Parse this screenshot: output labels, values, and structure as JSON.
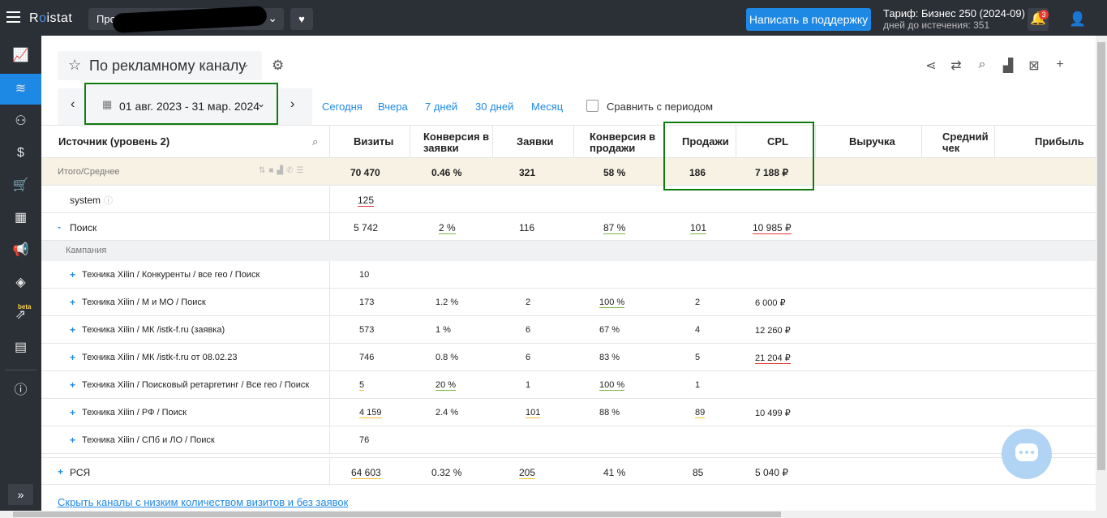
{
  "topbar": {
    "logo_pre": "R",
    "logo_dot": "o",
    "logo_post": "istat",
    "project": "Про",
    "support": "Написать в поддержку",
    "tariff": "Тариф: Бизнес 250 (2024-09)",
    "days": "дней до истечения: 351",
    "notifications": "3"
  },
  "sidebar": {
    "icons": [
      "analytics-icon",
      "layers-active-icon",
      "sitemap-icon",
      "money-icon",
      "cart-icon",
      "calendar-icon",
      "megaphone-icon",
      "stack-icon",
      "beta-report-icon",
      "scoreboard-icon",
      "info-icon"
    ],
    "beta": "beta",
    "expand": "»"
  },
  "report": {
    "title": "По рекламному каналу",
    "date_range": "01 авг. 2023 - 31 мар. 2024",
    "periods": [
      "Сегодня",
      "Вчера",
      "7 дней",
      "30 дней",
      "Месяц"
    ],
    "compare": "Сравнить с периодом"
  },
  "table": {
    "columns": {
      "source": "Источник (уровень 2)",
      "visits": "Визиты",
      "conv_req_1": "Конверсия в",
      "conv_req_2": "заявки",
      "requests": "Заявки",
      "conv_sales_1": "Конверсия в",
      "conv_sales_2": "продажи",
      "sales": "Продажи",
      "cpl": "CPL",
      "revenue": "Выручка",
      "avg_1": "Средний",
      "avg_2": "чек",
      "profit": "Прибыль"
    },
    "total": {
      "label": "Итого/Среднее",
      "visits": "70 470",
      "conv_req": "0.46 %",
      "requests": "321",
      "conv_sales": "58 %",
      "sales": "186",
      "cpl": "7 188 ₽"
    },
    "system": {
      "label": "system",
      "visits": "125"
    },
    "search": {
      "label": "Поиск",
      "toggle": "-",
      "visits": "5 742",
      "conv_req": "2 %",
      "requests": "116",
      "conv_sales": "87 %",
      "sales": "101",
      "cpl": "10 985 ₽"
    },
    "campaign_header": "Кампания",
    "campaigns": [
      {
        "label": "Техника Xilin / Конкуренты / все гео / Поиск",
        "visits": "10",
        "conv_req": "",
        "requests": "",
        "conv_sales": "",
        "sales": "",
        "cpl": ""
      },
      {
        "label": "Техника Xilin / М и МО / Поиск",
        "visits": "173",
        "conv_req": "1.2 %",
        "requests": "2",
        "conv_sales": "100 %",
        "sales": "2",
        "cpl": "6 000 ₽"
      },
      {
        "label": "Техника Xilin / МК /istk-f.ru (заявка)",
        "visits": "573",
        "conv_req": "1 %",
        "requests": "6",
        "conv_sales": "67 %",
        "sales": "4",
        "cpl": "12 260 ₽"
      },
      {
        "label": "Техника Xilin / МК /istk-f.ru от 08.02.23",
        "visits": "746",
        "conv_req": "0.8 %",
        "requests": "6",
        "conv_sales": "83 %",
        "sales": "5",
        "cpl": "21 204 ₽"
      },
      {
        "label": "Техника Xilin / Поисковый ретаргетинг / Все гео / Поиск",
        "visits": "5",
        "conv_req": "20 %",
        "requests": "1",
        "conv_sales": "100 %",
        "sales": "1",
        "cpl": ""
      },
      {
        "label": "Техника Xilin / РФ / Поиск",
        "visits": "4 159",
        "conv_req": "2.4 %",
        "requests": "101",
        "conv_sales": "88 %",
        "sales": "89",
        "cpl": "10 499 ₽"
      },
      {
        "label": "Техника Xilin / СПб и ЛО / Поиск",
        "visits": "76",
        "conv_req": "",
        "requests": "",
        "conv_sales": "",
        "sales": "",
        "cpl": ""
      }
    ],
    "rsya": {
      "label": "РСЯ",
      "toggle": "+",
      "visits": "64 603",
      "conv_req": "0.32 %",
      "requests": "205",
      "conv_sales": "41 %",
      "sales": "85",
      "cpl": "5 040 ₽"
    }
  },
  "footer_link": "Скрыть каналы с низким количеством визитов и без заявок"
}
